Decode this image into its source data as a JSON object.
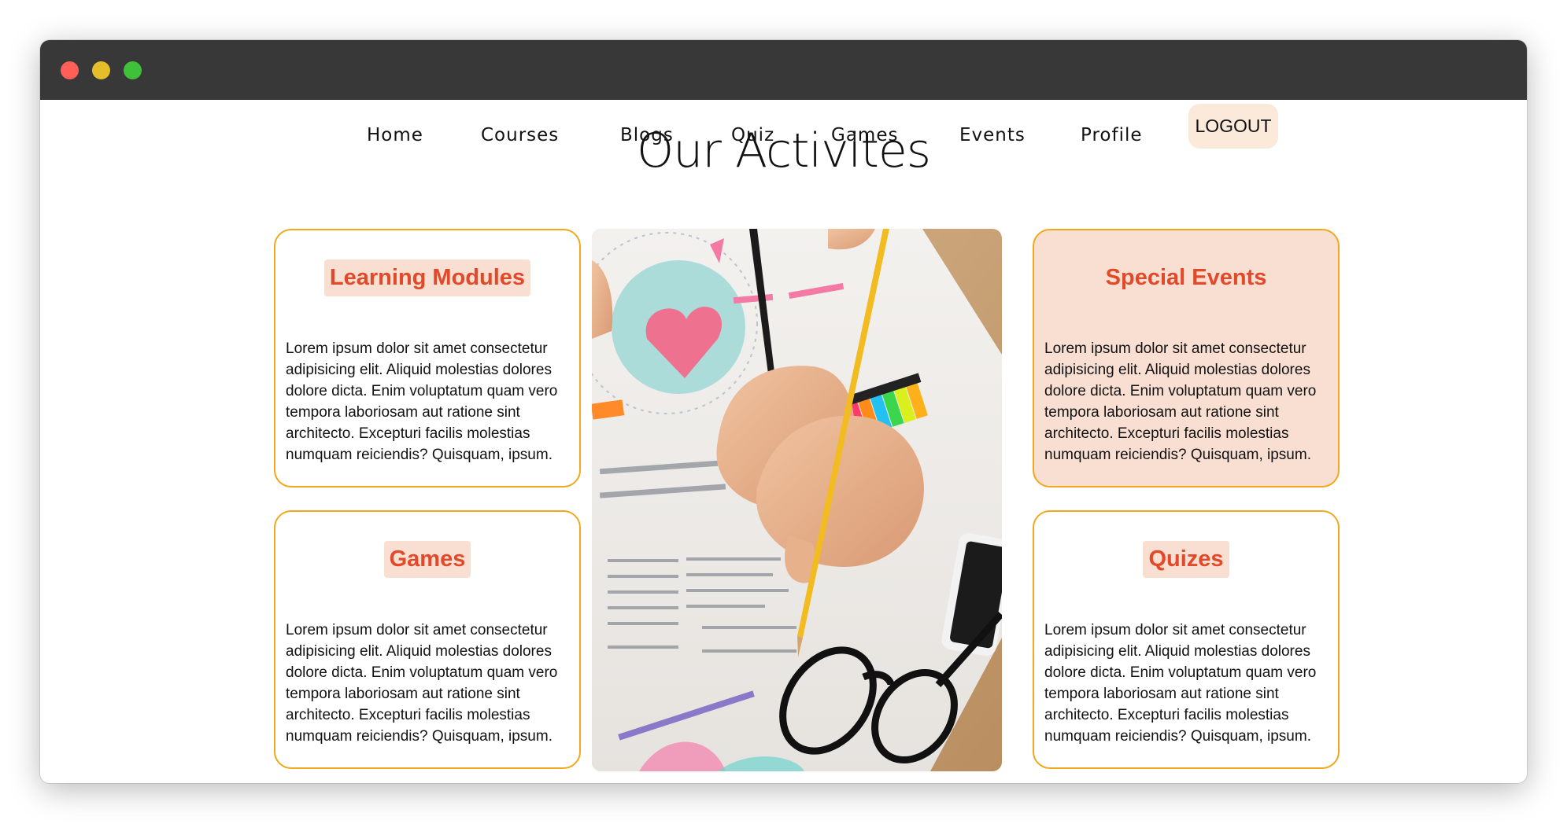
{
  "nav": {
    "items": [
      "Home",
      "Courses",
      "Blogs",
      "Quiz",
      "Games",
      "Events",
      "Profile"
    ],
    "logout": "LOGOUT"
  },
  "page_title": "Our Activites",
  "cards": [
    {
      "title": "Learning Modules",
      "text": "Lorem ipsum dolor sit amet consectetur adipisicing elit. Aliquid molestias dolores dolore dicta. Enim voluptatum quam vero tempora laboriosam aut ratione sint architecto. Excepturi facilis molestias numquam reiciendis? Quisquam, ipsum."
    },
    {
      "title": "Special Events",
      "text": "Lorem ipsum dolor sit amet consectetur adipisicing elit. Aliquid molestias dolores dolore dicta. Enim voluptatum quam vero tempora laboriosam aut ratione sint architecto. Excepturi facilis molestias numquam reiciendis? Quisquam, ipsum."
    },
    {
      "title": "Games",
      "text": "Lorem ipsum dolor sit amet consectetur adipisicing elit. Aliquid molestias dolores dolore dicta. Enim voluptatum quam vero tempora laboriosam aut ratione sint architecto. Excepturi facilis molestias numquam reiciendis? Quisquam, ipsum."
    },
    {
      "title": "Quizes",
      "text": "Lorem ipsum dolor sit amet consectetur adipisicing elit. Aliquid molestias dolores dolore dicta. Enim voluptatum quam vero tempora laboriosam aut ratione sint architecto. Excepturi facilis molestias numquam reiciendis? Quisquam, ipsum."
    }
  ],
  "colors": {
    "accent_orange": "#f1a81c",
    "title_red": "#e2492a",
    "title_bg": "#f9dfd2",
    "logout_bg": "#fbe9da",
    "titlebar": "#383838"
  },
  "photo_icon": "students-writing-photo"
}
